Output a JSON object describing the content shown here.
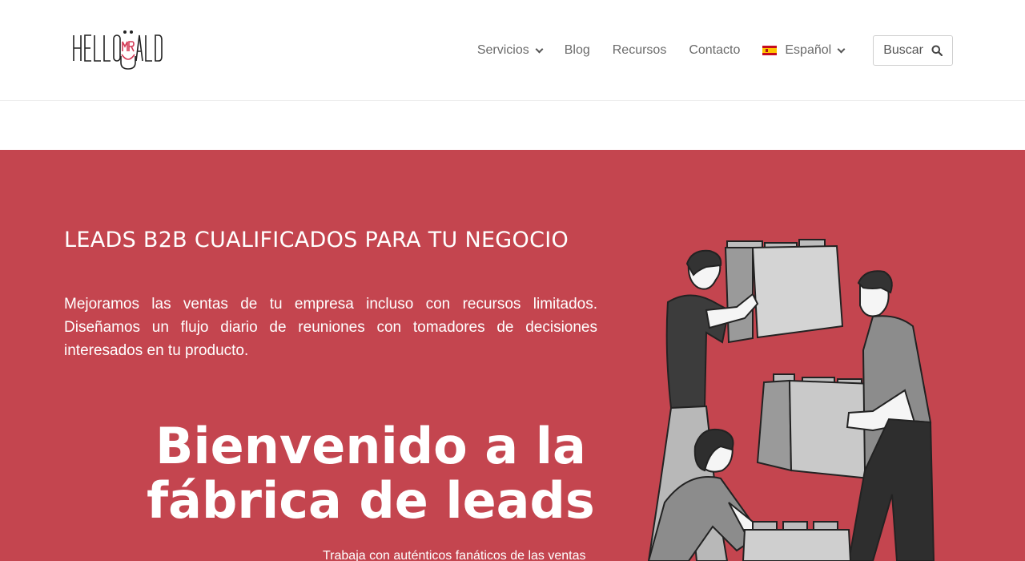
{
  "header": {
    "logo_text": "HELLOMRLEAD",
    "nav": [
      {
        "label": "Servicios",
        "has_dropdown": true
      },
      {
        "label": "Blog",
        "has_dropdown": false
      },
      {
        "label": "Recursos",
        "has_dropdown": false
      },
      {
        "label": "Contacto",
        "has_dropdown": false
      }
    ],
    "language": {
      "label": "Español",
      "flag_icon": "spain-flag-icon"
    },
    "search_label": "Buscar"
  },
  "hero": {
    "title": "LEADS B2B CUALIFICADOS PARA TU NEGOCIO",
    "description": "Mejoramos las ventas de tu empresa incluso con recursos limitados. Diseñamos un flujo diario de reuniones con tomadores de decisiones interesados en tu producto.",
    "headline": "Bienvenido a la fábrica de leads",
    "subtext": "Trabaja con auténticos fanáticos de las ventas"
  },
  "colors": {
    "accent": "#c4454f",
    "text_light": "#ffffff",
    "nav_text": "#6b6b6b"
  }
}
